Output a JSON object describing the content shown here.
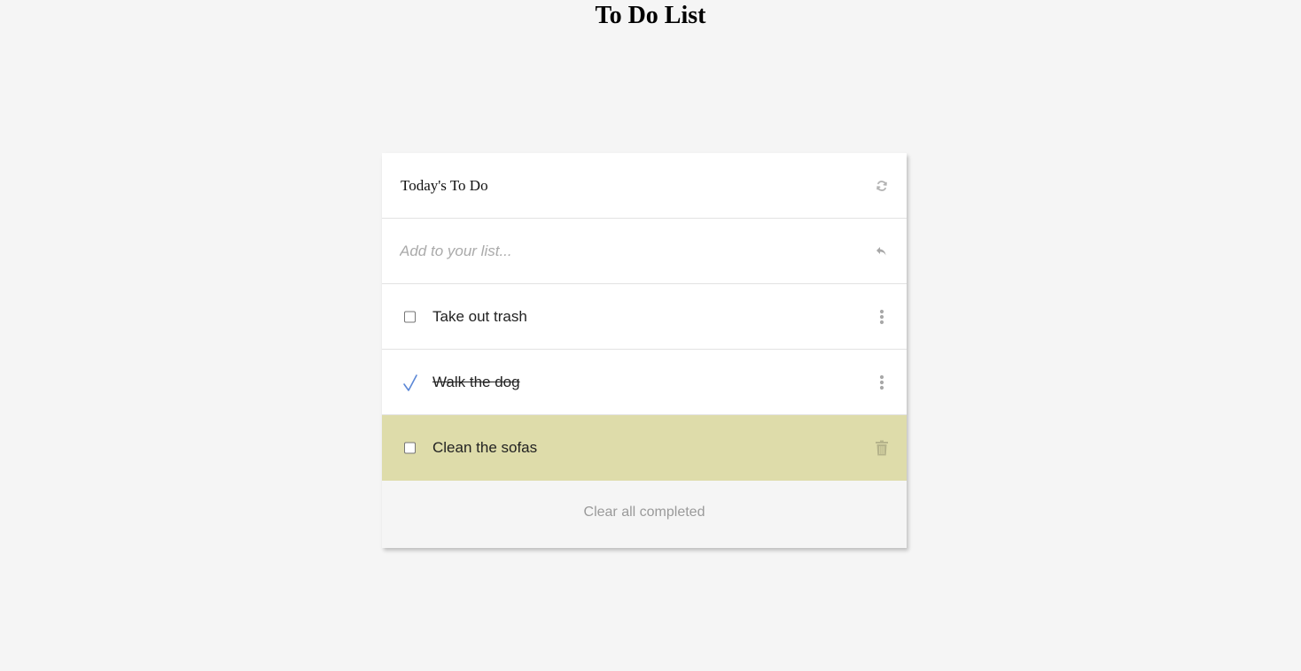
{
  "page": {
    "title": "To Do List"
  },
  "card": {
    "header_title": "Today's To Do",
    "refresh_icon": "refresh-icon",
    "add": {
      "placeholder": "Add to your list...",
      "value": "",
      "submit_icon": "reply-arrow-icon"
    },
    "items": [
      {
        "label": "Take out trash",
        "completed": false,
        "highlighted": false,
        "action_icon": "more-vertical-icon"
      },
      {
        "label": "Walk the dog",
        "completed": true,
        "highlighted": false,
        "action_icon": "more-vertical-icon"
      },
      {
        "label": "Clean the sofas",
        "completed": false,
        "highlighted": true,
        "action_icon": "trash-icon"
      }
    ],
    "footer_label": "Clear all completed"
  },
  "colors": {
    "background": "#f5f5f5",
    "card": "#ffffff",
    "highlight": "#dedcaa",
    "checkmark": "#5b87d6",
    "muted_icon": "#b3b3b3",
    "footer_text": "#9a9a9a"
  }
}
